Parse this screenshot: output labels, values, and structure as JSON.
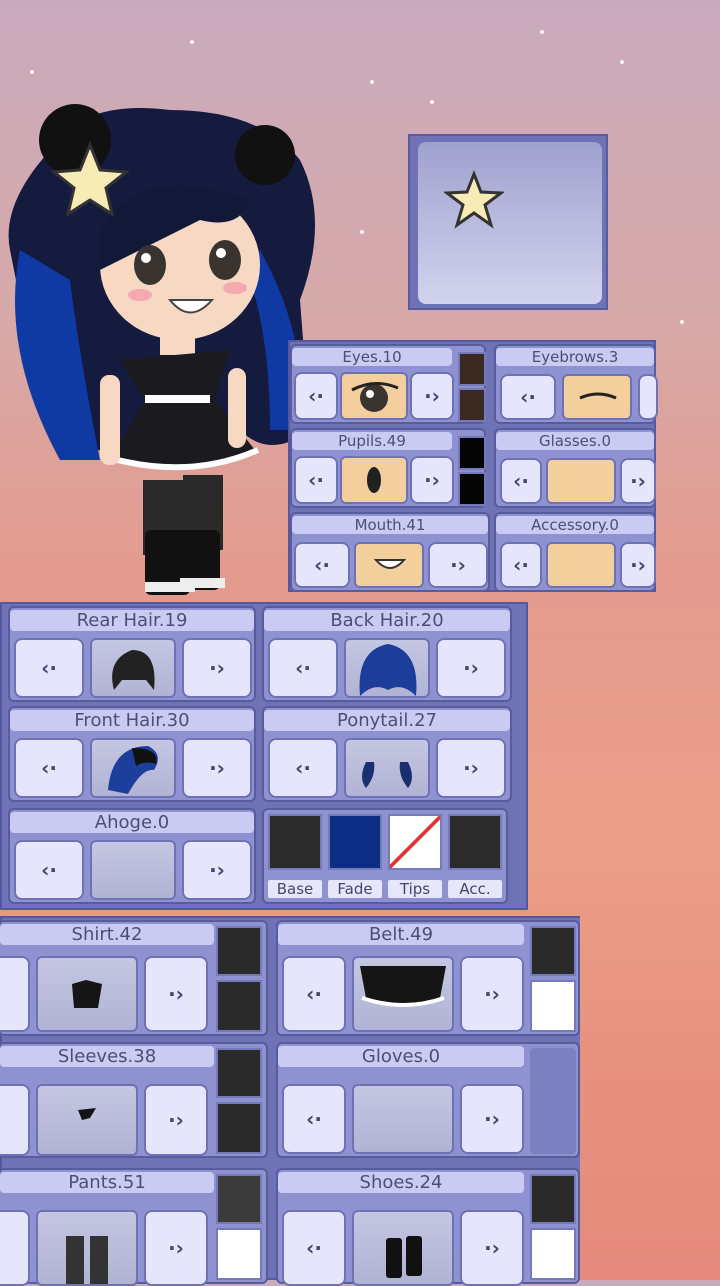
{
  "face": {
    "eyes": "Eyes.10",
    "eyebrows": "Eyebrows.3",
    "pupils": "Pupils.49",
    "glasses": "Glasses.0",
    "mouth": "Mouth.41",
    "accessory": "Accessory.0"
  },
  "hair": {
    "rear": "Rear Hair.19",
    "back": "Back Hair.20",
    "front": "Front Hair.30",
    "ponytail": "Ponytail.27",
    "ahoge": "Ahoge.0",
    "color_tabs": [
      "Base",
      "Fade",
      "Tips",
      "Acc."
    ]
  },
  "clothes": {
    "shirt": "Shirt.42",
    "belt": "Belt.49",
    "sleeves": "Sleeves.38",
    "gloves": "Gloves.0",
    "pants": "Pants.51",
    "shoes": "Shoes.24"
  },
  "colors": {
    "panel": "#6f73b6",
    "base_hair": "#2b2b2b",
    "fade_hair": "#0d2e84",
    "skin": "#f3cf9e"
  },
  "icons": {
    "left": "‹·",
    "right": "·›"
  }
}
